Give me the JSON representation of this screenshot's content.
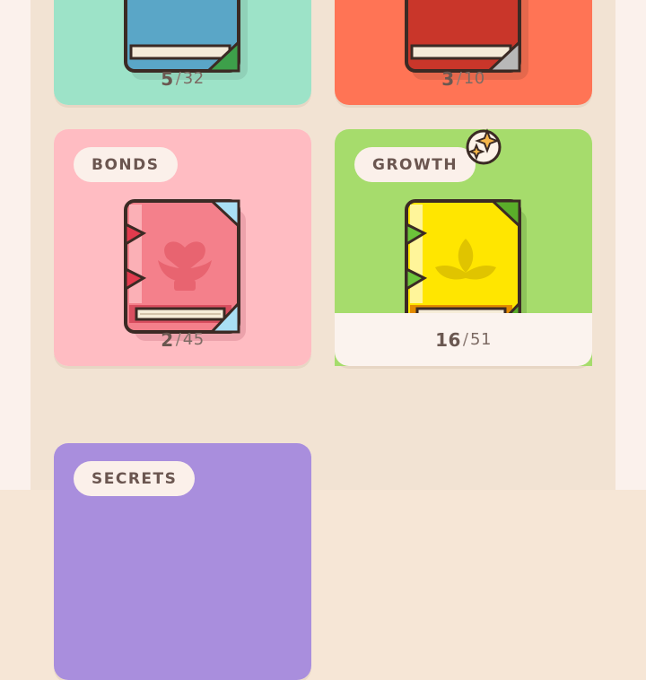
{
  "categories": [
    {
      "id": "c1",
      "label": "",
      "current": "5",
      "total": "32",
      "color": "#9de3c8"
    },
    {
      "id": "c2",
      "label": "",
      "current": "3",
      "total": "10",
      "color": "#ff7455"
    },
    {
      "id": "bonds",
      "label": "BONDS",
      "current": "2",
      "total": "45",
      "color": "#ffbcc2"
    },
    {
      "id": "growth",
      "label": "GROWTH",
      "current": "16",
      "total": "51",
      "color": "#a6dc6c",
      "new_badge": "sparkle-icon"
    },
    {
      "id": "secrets",
      "label": "SECRETS",
      "current": "",
      "total": "",
      "color": "#a98edd"
    }
  ],
  "separator": "/"
}
